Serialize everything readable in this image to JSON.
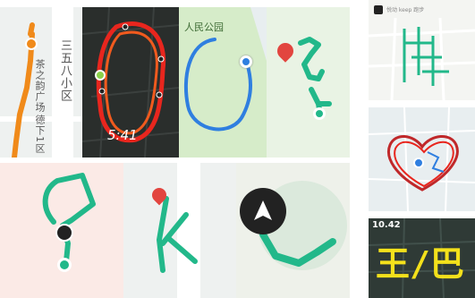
{
  "collage": {
    "colors": {
      "route_orange": "#f08a1a",
      "route_red": "#e8261e",
      "route_blue": "#2f7fe0",
      "route_green": "#22b88a",
      "route_yellow": "#f4e11b",
      "map_bg": "#e8eef0",
      "park_green": "#d6ecc9",
      "dark_bg": "#2a2e2c",
      "pin_red": "#e2453f",
      "nav_arrow_bg": "#222222"
    },
    "tiles": [
      {
        "name": "orange-route-map",
        "labels": {
          "road_name": "三五八小区",
          "place_top": "茶之韵广场",
          "place_bottom": "德下1区"
        },
        "icons": [
          "start-pin-icon"
        ]
      },
      {
        "name": "red-loop-route",
        "labels": {
          "time": "5:41"
        },
        "icons": [
          "start-pin-icon"
        ]
      },
      {
        "name": "blue-park-route",
        "labels": {
          "park_name": "人民公园"
        },
        "icons": [
          "location-dot-icon"
        ]
      },
      {
        "name": "green-letter-route",
        "labels": {},
        "icons": [
          "map-pin-icon",
          "start-pin-icon"
        ]
      },
      {
        "name": "app-grid-route",
        "labels": {
          "app_title": "悦动 keep 跑步"
        },
        "icons": [
          "app-logo-icon"
        ]
      },
      {
        "name": "heart-route",
        "labels": {},
        "icons": [
          "location-dot-icon"
        ]
      },
      {
        "name": "teal-shape-route",
        "labels": {},
        "icons": [
          "nav-arrow-icon",
          "start-pin-icon"
        ]
      },
      {
        "name": "green-k-route",
        "labels": {},
        "icons": [
          "map-pin-icon"
        ]
      },
      {
        "name": "nav-zoom-route",
        "labels": {},
        "icons": [
          "nav-arrow-icon"
        ]
      },
      {
        "name": "yellow-text-route",
        "labels": {
          "time": "10.42",
          "route_text": "王/巴"
        },
        "icons": []
      }
    ]
  }
}
